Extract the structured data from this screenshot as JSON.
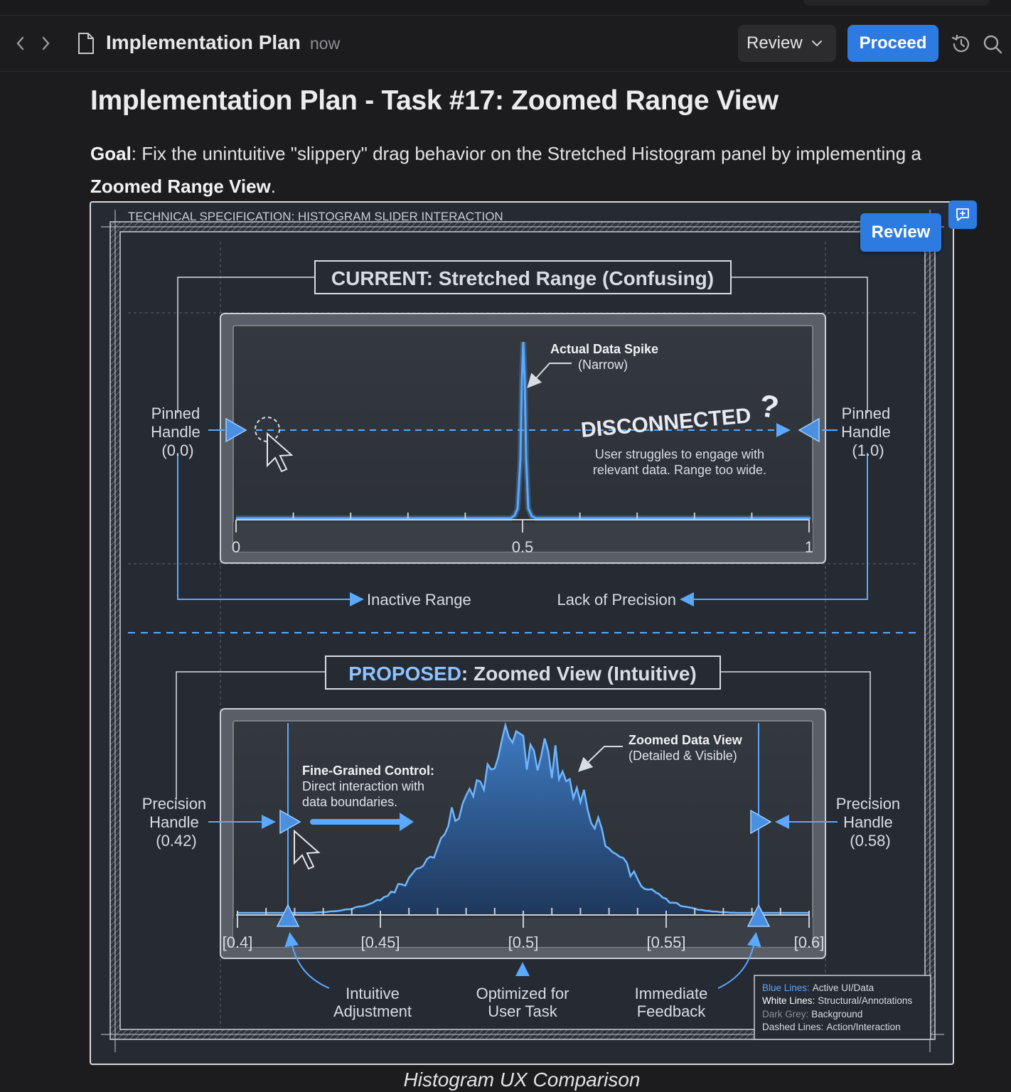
{
  "toolbar": {
    "back_icon": "chevron-left-icon",
    "forward_icon": "chevron-right-icon",
    "doc_icon": "document-icon",
    "doc_title": "Implementation Plan",
    "doc_time": "now",
    "review_label": "Review",
    "proceed_label": "Proceed",
    "history_icon": "history-icon",
    "search_icon": "search-icon"
  },
  "heading": "Implementation Plan - Task #17: Zoomed Range View",
  "goal": {
    "label": "Goal",
    "text1": ": Fix the unintuitive \"slippery\" drag behavior on the Stretched Histogram panel by implementing a ",
    "emph": "Zoomed Range View",
    "text2": "."
  },
  "figure": {
    "review_label": "Review",
    "comment_icon": "add-comment-icon",
    "caption": "Histogram UX Comparison",
    "spec_title": "TECHNICAL SPECIFICATION: HISTOGRAM SLIDER INTERACTION",
    "current": {
      "title_prefix": "CURRENT",
      "title_rest": ": Stretched Range (Confusing)",
      "left_handle": [
        "Pinned",
        "Handle",
        "(0.0)"
      ],
      "right_handle": [
        "Pinned",
        "Handle",
        "(1.0)"
      ],
      "spike_label": "Actual Data Spike",
      "spike_sub": "(Narrow)",
      "disconnected": "DISCONNECTED",
      "struggle1": "User struggles to engage with",
      "struggle2": "relevant data. Range too wide.",
      "ticks": [
        "0",
        "0.5",
        "1"
      ],
      "tick_values": [
        0,
        0.5,
        1
      ],
      "inactive": "Inactive Range",
      "precision": "Lack of Precision"
    },
    "proposed": {
      "title_prefix": "PROPOSED",
      "title_rest": ": Zoomed View (Intuitive)",
      "left_handle": [
        "Precision",
        "Handle",
        "(0.42)"
      ],
      "right_handle": [
        "Precision",
        "Handle",
        "(0.58)"
      ],
      "fine_title": "Fine-Grained Control:",
      "fine_1": "Direct interaction with",
      "fine_2": "data boundaries.",
      "zoom_title": "Zoomed Data View",
      "zoom_sub": "(Detailed & Visible)",
      "ticks": [
        "[0.4]",
        "[0.45]",
        "[0.5]",
        "[0.55]",
        "[0.6]"
      ],
      "tick_values": [
        0.4,
        0.45,
        0.5,
        0.55,
        0.6
      ],
      "note1": [
        "Intuitive",
        "Adjustment"
      ],
      "note2": [
        "Optimized for",
        "User Task"
      ],
      "note3": [
        "Immediate",
        "Feedback"
      ]
    },
    "legend": [
      {
        "key": "Blue Lines:",
        "val": "Active UI/Data"
      },
      {
        "key": "White Lines:",
        "val": "Structural/Annotations"
      },
      {
        "key": "Dark Grey:",
        "val": "Background"
      },
      {
        "key": "Dashed Lines:",
        "val": "Action/Interaction"
      }
    ],
    "colors": {
      "accent": "#5aa9ff",
      "line": "#d9dde3",
      "bg": "#252a33"
    }
  }
}
